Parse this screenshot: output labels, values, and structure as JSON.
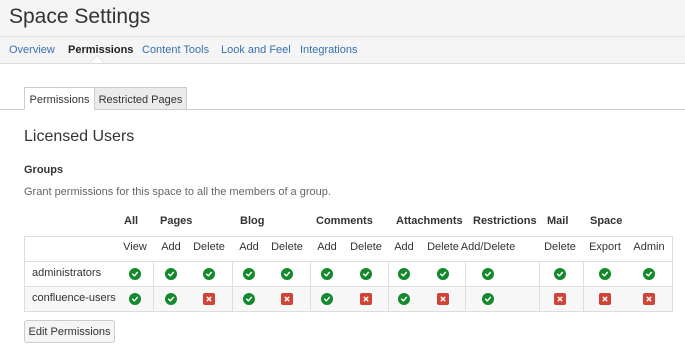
{
  "header": {
    "title": "Space Settings"
  },
  "nav": {
    "items": [
      {
        "label": "Overview"
      },
      {
        "label": "Permissions"
      },
      {
        "label": "Content Tools"
      },
      {
        "label": "Look and Feel"
      },
      {
        "label": "Integrations"
      }
    ],
    "active": "Permissions"
  },
  "subtabs": [
    {
      "label": "Permissions"
    },
    {
      "label": "Restricted Pages"
    }
  ],
  "section": {
    "title": "Licensed Users",
    "groups_heading": "Groups",
    "groups_description": "Grant permissions for this space to all the members of a group."
  },
  "table": {
    "categories": [
      {
        "label": "All"
      },
      {
        "label": "Pages"
      },
      {
        "label": "Blog"
      },
      {
        "label": "Comments"
      },
      {
        "label": "Attachments"
      },
      {
        "label": "Restrictions"
      },
      {
        "label": "Mail"
      },
      {
        "label": "Space"
      }
    ],
    "columns": [
      {
        "label": "View"
      },
      {
        "label": "Add"
      },
      {
        "label": "Delete"
      },
      {
        "label": "Add"
      },
      {
        "label": "Delete"
      },
      {
        "label": "Add"
      },
      {
        "label": "Delete"
      },
      {
        "label": "Add"
      },
      {
        "label": "Delete"
      },
      {
        "label": "Add/Delete"
      },
      {
        "label": "Delete"
      },
      {
        "label": "Export"
      },
      {
        "label": "Admin"
      }
    ],
    "rows": [
      {
        "group": "administrators",
        "permissions": [
          true,
          true,
          true,
          true,
          true,
          true,
          true,
          true,
          true,
          true,
          true,
          true,
          true
        ]
      },
      {
        "group": "confluence-users",
        "permissions": [
          true,
          true,
          false,
          true,
          false,
          true,
          false,
          true,
          false,
          true,
          false,
          false,
          false
        ]
      }
    ]
  },
  "edit_button": {
    "label": "Edit Permissions"
  },
  "colors": {
    "allow": "#14892c",
    "deny": "#d04437",
    "link": "#3572b0"
  },
  "icons": {
    "allow": "check-icon",
    "deny": "cross-icon"
  }
}
